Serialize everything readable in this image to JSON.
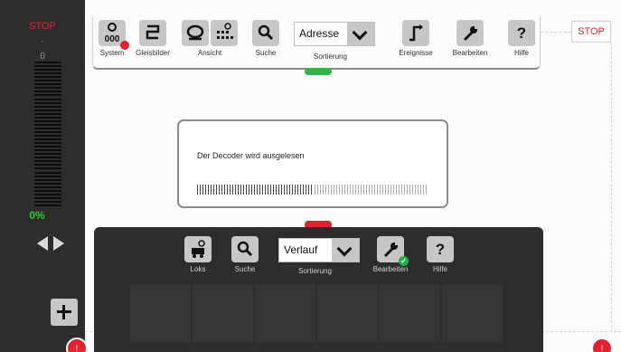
{
  "throttle": {
    "stop_label": "STOP",
    "dot": "-",
    "speed_value": "0",
    "percent": "0%",
    "speed_fraction": 0.0
  },
  "toolbar": {
    "items": [
      {
        "label": "System",
        "icon": "system-icon"
      },
      {
        "label": "Gleisbilder",
        "icon": "track-layout-icon"
      },
      {
        "label": "Ansicht",
        "icon": "view-icon"
      },
      {
        "label": "Suche",
        "icon": "search-icon"
      },
      {
        "label": "Ereignisse",
        "icon": "events-icon"
      },
      {
        "label": "Bearbeiten",
        "icon": "wrench-icon"
      },
      {
        "label": "Hilfe",
        "icon": "help-icon"
      }
    ],
    "sort": {
      "value": "Adresse",
      "label": "Sortierung"
    },
    "stop_label": "STOP"
  },
  "dialog": {
    "message": "Der Decoder wird ausgelesen",
    "progress_fraction": 0.5
  },
  "lok_panel": {
    "items": [
      {
        "label": "Loks",
        "icon": "locomotive-icon"
      },
      {
        "label": "Suche",
        "icon": "search-icon"
      },
      {
        "label": "Bearbeiten",
        "icon": "wrench-icon"
      },
      {
        "label": "Hilfe",
        "icon": "help-icon"
      }
    ],
    "sort": {
      "value": "Verlauf",
      "label": "Sortierung"
    },
    "add_icon": "plus-icon"
  },
  "colors": {
    "stop_red": "#e0232f",
    "speed_green": "#27d03a",
    "panel_dark": "#2d2d2d",
    "button_grey": "#c7c7c7",
    "handle_green": "#2fb44a"
  }
}
